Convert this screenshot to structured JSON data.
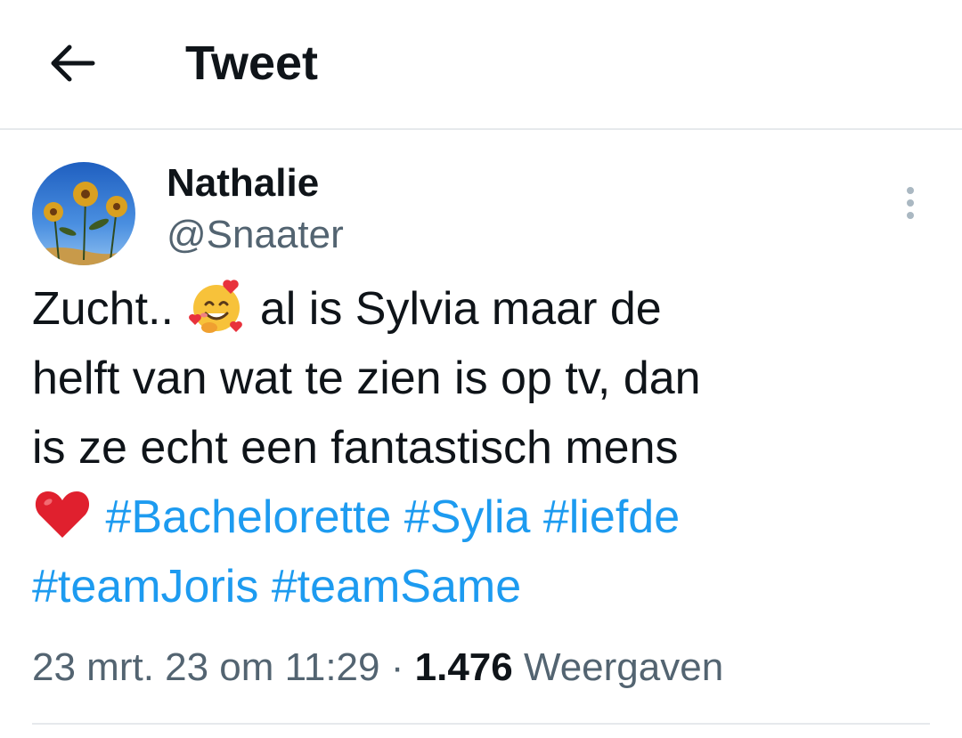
{
  "header": {
    "title": "Tweet",
    "back_icon": "arrow-left-icon"
  },
  "author": {
    "display_name": "Nathalie",
    "handle": "@Snaater",
    "avatar_icon": "sunflower-photo"
  },
  "tweet": {
    "text_line1": "Zucht..",
    "emoji_1": "smiling-face-with-hearts",
    "text_line1b": "al is Sylvia maar de",
    "text_line2": "helft van wat te zien is op tv, dan",
    "text_line3": "is ze echt een fantastisch mens",
    "emoji_2": "red-heart",
    "hashtags": [
      "#Bachelorette",
      "#Sylia",
      "#liefde",
      "#teamJoris",
      "#teamSame"
    ]
  },
  "meta": {
    "datetime": "23 mrt. 23 om 11:29",
    "separator": "·",
    "views_count": "1.476",
    "views_label": "Weergaven"
  },
  "more_icon": "more-vertical-icon",
  "colors": {
    "text": "#0f1419",
    "secondary": "#536471",
    "link": "#1d9bf0",
    "divider": "#e6e9ec"
  }
}
